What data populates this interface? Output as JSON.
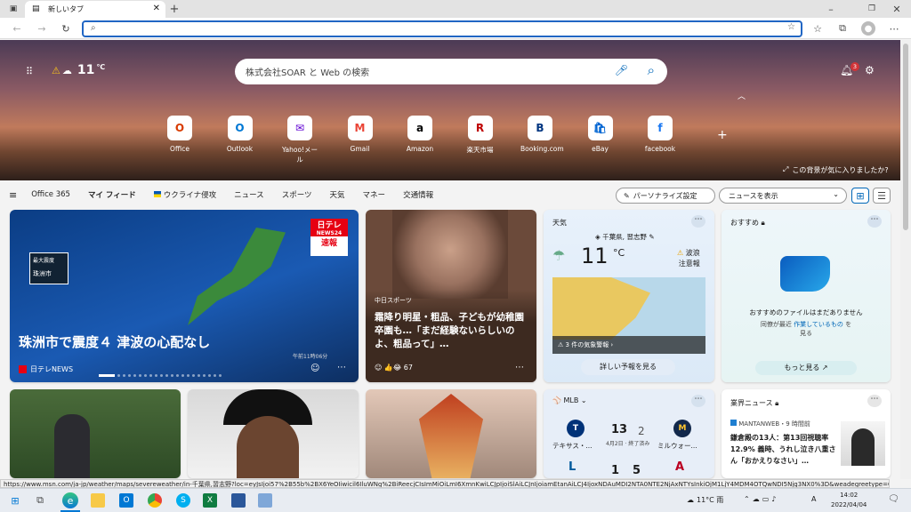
{
  "browser": {
    "tab_title": "新しいタブ",
    "address_value": "",
    "status_url": "https://www.msn.com/ja-jp/weather/maps/severeweather/in-千葉県,習志野?loc=eyJsIjoi57%2B55b%2BX6YeOIiwicil6IluWNg%2BiReecjCIsImMiOiLmI6XmnKwiLCJpIjoiSlAiLCJnIjoiamEtanAiLCJ4IjoxNDAuMDI2NTA0NTE2NjAxNTYsInkiOjM1LjY4MDM4OTQwNDI5Njg3NX0%3D&weadegreetype=C&..."
  },
  "hero": {
    "temp": "11",
    "unit": "℃",
    "search_placeholder": "株式会社SOAR と Web の検索",
    "notif_count": "3",
    "feedback": "この背景が気に入りましたか?"
  },
  "quicklinks": [
    {
      "label": "Office",
      "glyph": "O",
      "color": "#d83b01"
    },
    {
      "label": "Outlook",
      "glyph": "O",
      "color": "#0078d4"
    },
    {
      "label": "Yahoo!メール",
      "glyph": "✉",
      "color": "#6001d2"
    },
    {
      "label": "Gmail",
      "glyph": "M",
      "color": "#ea4335"
    },
    {
      "label": "Amazon",
      "glyph": "a",
      "color": "#000"
    },
    {
      "label": "楽天市場",
      "glyph": "R",
      "color": "#bf0000"
    },
    {
      "label": "Booking.com",
      "glyph": "B",
      "color": "#003580"
    },
    {
      "label": "eBay",
      "glyph": "🛍",
      "color": "#0064d2"
    },
    {
      "label": "facebook",
      "glyph": "f",
      "color": "#1877f2"
    }
  ],
  "nav": {
    "items": [
      "Office 365",
      "マイ フィード",
      "ウクライナ侵攻",
      "ニュース",
      "スポーツ",
      "天気",
      "マネー",
      "交通情報"
    ],
    "personalize": "パーソナライズ設定",
    "show": "ニュースを表示"
  },
  "main_card": {
    "headline": "珠洲市で震度４ 津波の心配なし",
    "source": "日テレNEWS",
    "badge_top": "日テレ",
    "badge_mid": "NEWS24",
    "badge_bot": "速報",
    "map_label1": "最大震度",
    "map_label2": "珠洲市",
    "time": "午前11時06分"
  },
  "card2": {
    "source": "中日スポーツ",
    "headline": "霜降り明星・粗品、子どもが幼稚園卒園も…「まだ経験ないらしいのよ、粗品って」…",
    "likes": "67"
  },
  "weather": {
    "title": "天気",
    "location": "千葉県, 習志野",
    "temp": "11",
    "unit": "°C",
    "alert1": "波浪",
    "alert2": "注意報",
    "alerts_count": "3 件の気象警報",
    "more": "詳しい予報を見る"
  },
  "recommend": {
    "title": "おすすめ",
    "msg1": "おすすめのファイルはまだありません",
    "msg2": "同僚が最近",
    "link": "作業しているもの",
    "msg3": "を",
    "msg4": "見る",
    "more": "もっと見る"
  },
  "mlb": {
    "title": "MLB",
    "team1": "テキサス・...",
    "team2": "ミルウォー...",
    "score1": "13",
    "score2": "2",
    "date": "4月2日",
    "status": "終了済み",
    "score3": "1",
    "score4": "5"
  },
  "industry": {
    "title": "業界ニュース",
    "source": "MANTANWEB・9 時間前",
    "headline": "鎌倉殿の13人：第13回視聴率12.9% 義時、うれし泣き八重さん「おかえりなさい」…"
  },
  "taskbar": {
    "weather": "11°C 雨",
    "time": "14:02",
    "date": "2022/04/04",
    "ime": "A"
  }
}
